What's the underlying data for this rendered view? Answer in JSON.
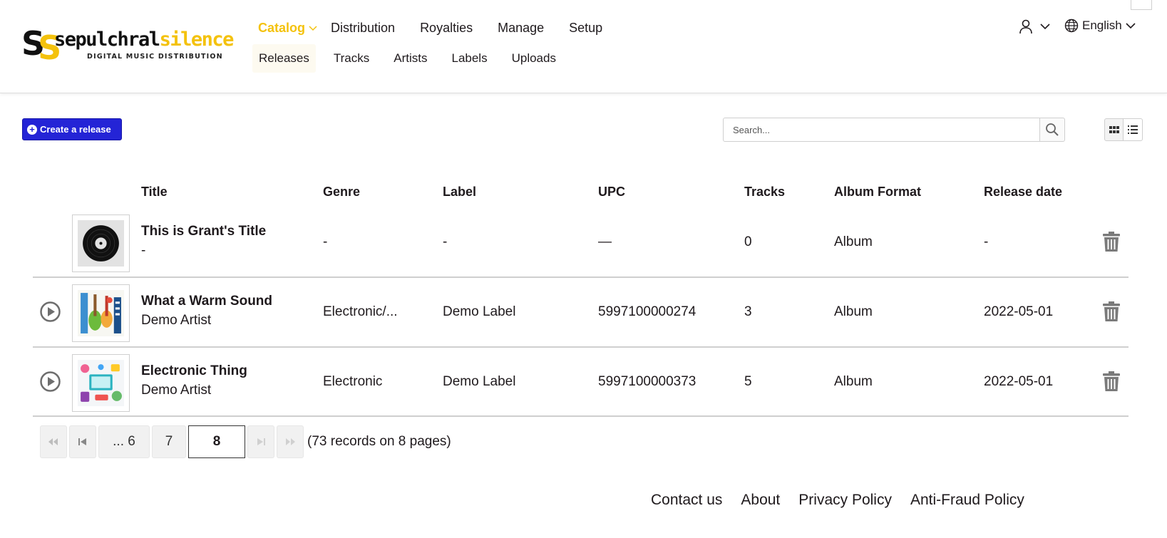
{
  "brand": {
    "logo_mark_1": "S",
    "logo_mark_2": "S",
    "name_part1": "sepulchral",
    "name_part2": "silence",
    "tagline": "DIGITAL MUSIC DISTRIBUTION",
    "accent_color": "#f4c20d"
  },
  "nav": {
    "main": [
      {
        "label": "Catalog",
        "active": true
      },
      {
        "label": "Distribution"
      },
      {
        "label": "Royalties"
      },
      {
        "label": "Manage"
      },
      {
        "label": "Setup"
      }
    ],
    "sub": [
      {
        "label": "Releases",
        "active": true
      },
      {
        "label": "Tracks"
      },
      {
        "label": "Artists"
      },
      {
        "label": "Labels"
      },
      {
        "label": "Uploads"
      }
    ]
  },
  "header_right": {
    "user_icon": "user-icon",
    "language": "English"
  },
  "toolbar": {
    "create_label": "Create a release",
    "create_color": "#2424d6",
    "search_placeholder": "Search..."
  },
  "table": {
    "columns": [
      "Title",
      "Genre",
      "Label",
      "UPC",
      "Tracks",
      "Album Format",
      "Release date"
    ],
    "rows": [
      {
        "title": "This is Grant's Title",
        "artist": "-",
        "genre": "-",
        "label": "-",
        "upc": "—",
        "tracks": "0",
        "format": "Album",
        "release_date": "-",
        "has_play": false,
        "artwork": "vinyl-record"
      },
      {
        "title": "What a Warm Sound",
        "artist": "Demo Artist",
        "genre": "Electronic/...",
        "label": "Demo Label",
        "upc": "5997100000274",
        "tracks": "3",
        "format": "Album",
        "release_date": "2022-05-01",
        "has_play": true,
        "artwork": "instruments"
      },
      {
        "title": "Electronic Thing",
        "artist": "Demo Artist",
        "genre": "Electronic",
        "label": "Demo Label",
        "upc": "5997100000373",
        "tracks": "5",
        "format": "Album",
        "release_date": "2022-05-01",
        "has_play": true,
        "artwork": "devices"
      }
    ]
  },
  "pagination": {
    "first_icon": "first-page-icon",
    "prev_icon": "prev-page-icon",
    "pages": [
      "... 6",
      "7"
    ],
    "current": "8",
    "next_icon": "next-page-icon",
    "last_icon": "last-page-icon",
    "info": "(73 records on 8 pages)"
  },
  "footer": {
    "links": [
      "Contact us",
      "About",
      "Privacy Policy",
      "Anti-Fraud Policy"
    ]
  }
}
